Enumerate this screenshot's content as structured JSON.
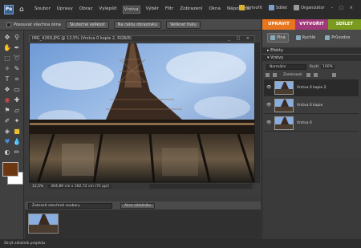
{
  "app": {
    "logo": "Pe",
    "menu": [
      "Soubor",
      "Úpravy",
      "Obraz",
      "Vylepšit",
      "Vrstva",
      "Výběr",
      "Filtr",
      "Zobrazení",
      "Okna",
      "Nápověda"
    ],
    "active_menu": "Vrstva",
    "right": {
      "create": "Vytvořit",
      "share": "Sdílet",
      "organizer": "Organizátor"
    }
  },
  "options_bar": {
    "checkbox_label": "Posouvat všechna okna",
    "buttons": [
      "Skutečné velikost",
      "Na celou obrazovku",
      "Velikost tisku"
    ]
  },
  "mode_tabs": [
    {
      "label": "UPRAVIT",
      "color": "#e8761e"
    },
    {
      "label": "VYTVOŘIT",
      "color": "#a13a7a"
    },
    {
      "label": "SDÍLET",
      "color": "#7a9a20"
    }
  ],
  "document": {
    "title": "IMG_4269.JPG @ 12,5% (Vrstva 0 kopie 2, RGB/8)",
    "window_controls": "_ □ ×",
    "zoom": "12,5%",
    "dimensions": "304,89 cm x 182,72 cm (72 ppi)"
  },
  "swatches": {
    "foreground": "#6e3714",
    "background": "#ffffff"
  },
  "project_bin": {
    "select": "Zobrazit otevřené soubory",
    "button": "Akce záložníku"
  },
  "panel": {
    "subtabs": [
      "Plná",
      "Rychlé",
      "Průvodce"
    ],
    "effects_label": "Efekty",
    "layers_label": "Vrstvy",
    "blend_mode": "Normální",
    "opacity_label": "Krytí:",
    "opacity_value": "100%",
    "lock_label": "Zamknout:",
    "layers": [
      {
        "name": "Vrstva 0 kopie 2",
        "selected": true
      },
      {
        "name": "Vrstva 0 kopie",
        "selected": false
      },
      {
        "name": "Vrstva 0",
        "selected": false
      }
    ]
  },
  "status": {
    "text": "Skrýt záložník projektu"
  }
}
